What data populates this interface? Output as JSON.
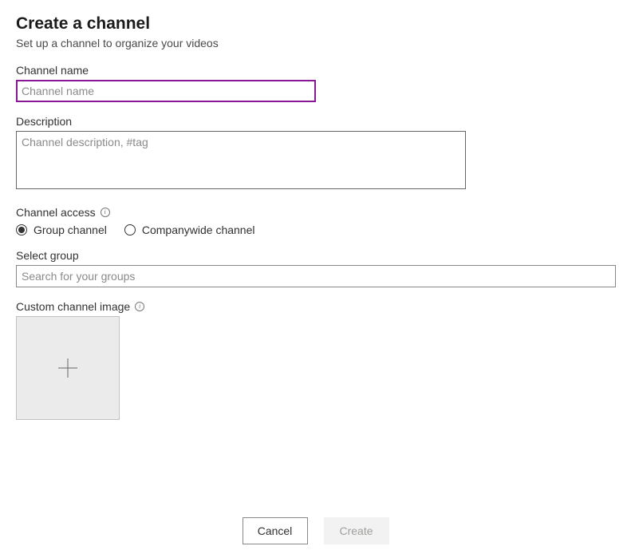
{
  "header": {
    "title": "Create a channel",
    "subtitle": "Set up a channel to organize your videos"
  },
  "channel_name": {
    "label": "Channel name",
    "placeholder": "Channel name",
    "value": ""
  },
  "description": {
    "label": "Description",
    "placeholder": "Channel description, #tag",
    "value": ""
  },
  "channel_access": {
    "label": "Channel access",
    "options": {
      "group": "Group channel",
      "company": "Companywide channel"
    },
    "selected": "group"
  },
  "select_group": {
    "label": "Select group",
    "placeholder": "Search for your groups",
    "value": ""
  },
  "custom_image": {
    "label": "Custom channel image"
  },
  "buttons": {
    "cancel": "Cancel",
    "create": "Create"
  }
}
